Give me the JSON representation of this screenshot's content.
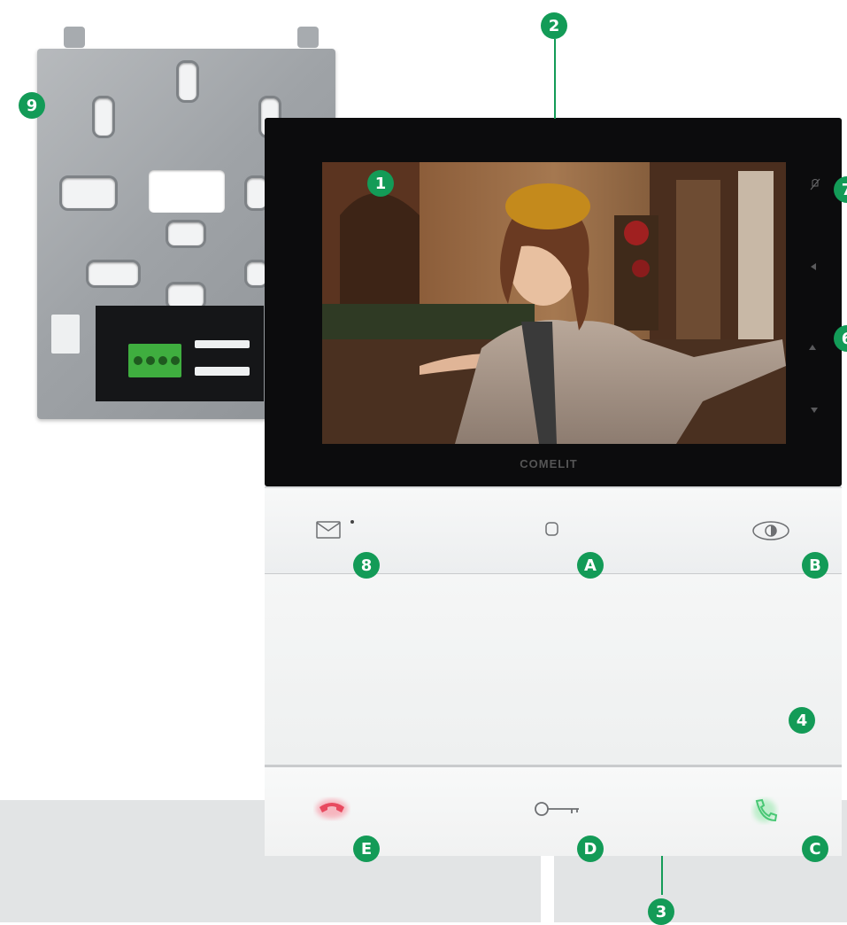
{
  "brand": "COMELIT",
  "callouts": {
    "c1": "1",
    "c2": "2",
    "c3": "3",
    "c4": "4",
    "c7": "7",
    "c6": "6",
    "c8": "8",
    "c9": "9",
    "cA": "A",
    "cB": "B",
    "cC": "C",
    "cD": "D",
    "cE": "E"
  },
  "icons": {
    "mail": "mail-icon",
    "home": "home-button-icon",
    "eye": "eye-icon",
    "hangup": "hang-up-icon",
    "key": "door-key-icon",
    "answer": "answer-call-icon",
    "mute": "mute-icon",
    "left": "left-arrow-icon",
    "up": "up-arrow-icon",
    "down": "down-arrow-icon"
  },
  "colors": {
    "callout": "#139b57",
    "hangup": "#e84a5f",
    "answer": "#48c774",
    "bezel": "#0c0c0d"
  }
}
